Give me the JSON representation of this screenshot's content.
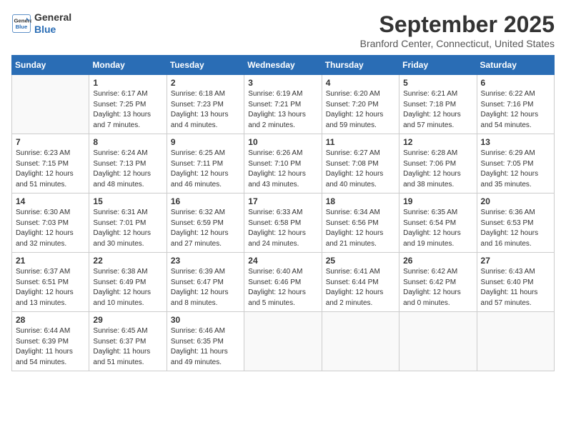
{
  "logo": {
    "line1": "General",
    "line2": "Blue"
  },
  "title": "September 2025",
  "location": "Branford Center, Connecticut, United States",
  "headers": [
    "Sunday",
    "Monday",
    "Tuesday",
    "Wednesday",
    "Thursday",
    "Friday",
    "Saturday"
  ],
  "weeks": [
    [
      {
        "day": "",
        "sunrise": "",
        "sunset": "",
        "daylight": ""
      },
      {
        "day": "1",
        "sunrise": "Sunrise: 6:17 AM",
        "sunset": "Sunset: 7:25 PM",
        "daylight": "Daylight: 13 hours and 7 minutes."
      },
      {
        "day": "2",
        "sunrise": "Sunrise: 6:18 AM",
        "sunset": "Sunset: 7:23 PM",
        "daylight": "Daylight: 13 hours and 4 minutes."
      },
      {
        "day": "3",
        "sunrise": "Sunrise: 6:19 AM",
        "sunset": "Sunset: 7:21 PM",
        "daylight": "Daylight: 13 hours and 2 minutes."
      },
      {
        "day": "4",
        "sunrise": "Sunrise: 6:20 AM",
        "sunset": "Sunset: 7:20 PM",
        "daylight": "Daylight: 12 hours and 59 minutes."
      },
      {
        "day": "5",
        "sunrise": "Sunrise: 6:21 AM",
        "sunset": "Sunset: 7:18 PM",
        "daylight": "Daylight: 12 hours and 57 minutes."
      },
      {
        "day": "6",
        "sunrise": "Sunrise: 6:22 AM",
        "sunset": "Sunset: 7:16 PM",
        "daylight": "Daylight: 12 hours and 54 minutes."
      }
    ],
    [
      {
        "day": "7",
        "sunrise": "Sunrise: 6:23 AM",
        "sunset": "Sunset: 7:15 PM",
        "daylight": "Daylight: 12 hours and 51 minutes."
      },
      {
        "day": "8",
        "sunrise": "Sunrise: 6:24 AM",
        "sunset": "Sunset: 7:13 PM",
        "daylight": "Daylight: 12 hours and 48 minutes."
      },
      {
        "day": "9",
        "sunrise": "Sunrise: 6:25 AM",
        "sunset": "Sunset: 7:11 PM",
        "daylight": "Daylight: 12 hours and 46 minutes."
      },
      {
        "day": "10",
        "sunrise": "Sunrise: 6:26 AM",
        "sunset": "Sunset: 7:10 PM",
        "daylight": "Daylight: 12 hours and 43 minutes."
      },
      {
        "day": "11",
        "sunrise": "Sunrise: 6:27 AM",
        "sunset": "Sunset: 7:08 PM",
        "daylight": "Daylight: 12 hours and 40 minutes."
      },
      {
        "day": "12",
        "sunrise": "Sunrise: 6:28 AM",
        "sunset": "Sunset: 7:06 PM",
        "daylight": "Daylight: 12 hours and 38 minutes."
      },
      {
        "day": "13",
        "sunrise": "Sunrise: 6:29 AM",
        "sunset": "Sunset: 7:05 PM",
        "daylight": "Daylight: 12 hours and 35 minutes."
      }
    ],
    [
      {
        "day": "14",
        "sunrise": "Sunrise: 6:30 AM",
        "sunset": "Sunset: 7:03 PM",
        "daylight": "Daylight: 12 hours and 32 minutes."
      },
      {
        "day": "15",
        "sunrise": "Sunrise: 6:31 AM",
        "sunset": "Sunset: 7:01 PM",
        "daylight": "Daylight: 12 hours and 30 minutes."
      },
      {
        "day": "16",
        "sunrise": "Sunrise: 6:32 AM",
        "sunset": "Sunset: 6:59 PM",
        "daylight": "Daylight: 12 hours and 27 minutes."
      },
      {
        "day": "17",
        "sunrise": "Sunrise: 6:33 AM",
        "sunset": "Sunset: 6:58 PM",
        "daylight": "Daylight: 12 hours and 24 minutes."
      },
      {
        "day": "18",
        "sunrise": "Sunrise: 6:34 AM",
        "sunset": "Sunset: 6:56 PM",
        "daylight": "Daylight: 12 hours and 21 minutes."
      },
      {
        "day": "19",
        "sunrise": "Sunrise: 6:35 AM",
        "sunset": "Sunset: 6:54 PM",
        "daylight": "Daylight: 12 hours and 19 minutes."
      },
      {
        "day": "20",
        "sunrise": "Sunrise: 6:36 AM",
        "sunset": "Sunset: 6:53 PM",
        "daylight": "Daylight: 12 hours and 16 minutes."
      }
    ],
    [
      {
        "day": "21",
        "sunrise": "Sunrise: 6:37 AM",
        "sunset": "Sunset: 6:51 PM",
        "daylight": "Daylight: 12 hours and 13 minutes."
      },
      {
        "day": "22",
        "sunrise": "Sunrise: 6:38 AM",
        "sunset": "Sunset: 6:49 PM",
        "daylight": "Daylight: 12 hours and 10 minutes."
      },
      {
        "day": "23",
        "sunrise": "Sunrise: 6:39 AM",
        "sunset": "Sunset: 6:47 PM",
        "daylight": "Daylight: 12 hours and 8 minutes."
      },
      {
        "day": "24",
        "sunrise": "Sunrise: 6:40 AM",
        "sunset": "Sunset: 6:46 PM",
        "daylight": "Daylight: 12 hours and 5 minutes."
      },
      {
        "day": "25",
        "sunrise": "Sunrise: 6:41 AM",
        "sunset": "Sunset: 6:44 PM",
        "daylight": "Daylight: 12 hours and 2 minutes."
      },
      {
        "day": "26",
        "sunrise": "Sunrise: 6:42 AM",
        "sunset": "Sunset: 6:42 PM",
        "daylight": "Daylight: 12 hours and 0 minutes."
      },
      {
        "day": "27",
        "sunrise": "Sunrise: 6:43 AM",
        "sunset": "Sunset: 6:40 PM",
        "daylight": "Daylight: 11 hours and 57 minutes."
      }
    ],
    [
      {
        "day": "28",
        "sunrise": "Sunrise: 6:44 AM",
        "sunset": "Sunset: 6:39 PM",
        "daylight": "Daylight: 11 hours and 54 minutes."
      },
      {
        "day": "29",
        "sunrise": "Sunrise: 6:45 AM",
        "sunset": "Sunset: 6:37 PM",
        "daylight": "Daylight: 11 hours and 51 minutes."
      },
      {
        "day": "30",
        "sunrise": "Sunrise: 6:46 AM",
        "sunset": "Sunset: 6:35 PM",
        "daylight": "Daylight: 11 hours and 49 minutes."
      },
      {
        "day": "",
        "sunrise": "",
        "sunset": "",
        "daylight": ""
      },
      {
        "day": "",
        "sunrise": "",
        "sunset": "",
        "daylight": ""
      },
      {
        "day": "",
        "sunrise": "",
        "sunset": "",
        "daylight": ""
      },
      {
        "day": "",
        "sunrise": "",
        "sunset": "",
        "daylight": ""
      }
    ]
  ]
}
